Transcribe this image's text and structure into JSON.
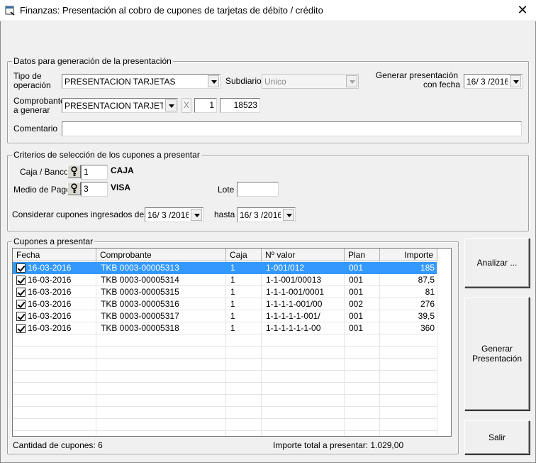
{
  "window": {
    "title": "Finanzas: Presentación al cobro de cupones de tarjetas de débito / crédito",
    "close_glyph": "✕"
  },
  "datos": {
    "legend": "Datos para generación de la presentación",
    "tipo_label_1": "Tipo de",
    "tipo_label_2": "operación",
    "tipo_value": "PRESENTACION TARJETAS",
    "subdiario_label": "Subdiario",
    "subdiario_value": "Unico",
    "generar_label_1": "Generar presentación",
    "generar_label_2": "con fecha",
    "generar_fecha": "16/ 3 /2016",
    "comprobante_label_1": "Comprobante",
    "comprobante_label_2": "a generar",
    "comprobante_value": "PRESENTACION TARJETAS",
    "comprobante_letra": "X",
    "comprobante_sucursal": "1",
    "comprobante_numero": "18523",
    "comentario_label": "Comentario",
    "comentario_value": ""
  },
  "criterios": {
    "legend": "Criterios de selección de los cupones a presentar",
    "caja_label": "Caja / Banco",
    "caja_code": "1",
    "caja_name": "CAJA",
    "medio_label": "Medio de Pago",
    "medio_code": "3",
    "medio_name": "VISA",
    "lote_label": "Lote",
    "lote_value": "",
    "desde_label": "Considerar cupones ingresados desde",
    "desde_value": "16/ 3 /2016",
    "hasta_label": "hasta",
    "hasta_value": "16/ 3 /2016"
  },
  "cupones": {
    "legend": "Cupones a presentar",
    "columns": [
      "Fecha",
      "Comprobante",
      "Caja",
      "Nº valor",
      "Plan",
      "Importe"
    ],
    "rows": [
      {
        "fecha": "16-03-2016",
        "comprobante": "TKB 0003-00005313",
        "caja": "1",
        "nvalor": "1-001/012",
        "plan": "001",
        "importe": "185",
        "selected": true
      },
      {
        "fecha": "16-03-2016",
        "comprobante": "TKB 0003-00005314",
        "caja": "1",
        "nvalor": "1-1-001/00013",
        "plan": "001",
        "importe": "87,5",
        "selected": false
      },
      {
        "fecha": "16-03-2016",
        "comprobante": "TKB 0003-00005315",
        "caja": "1",
        "nvalor": "1-1-1-001/0001",
        "plan": "001",
        "importe": "81",
        "selected": false
      },
      {
        "fecha": "16-03-2016",
        "comprobante": "TKB 0003-00005316",
        "caja": "1",
        "nvalor": "1-1-1-1-001/00",
        "plan": "002",
        "importe": "276",
        "selected": false
      },
      {
        "fecha": "16-03-2016",
        "comprobante": "TKB 0003-00005317",
        "caja": "1",
        "nvalor": "1-1-1-1-1-001/",
        "plan": "001",
        "importe": "39,5",
        "selected": false
      },
      {
        "fecha": "16-03-2016",
        "comprobante": "TKB 0003-00005318",
        "caja": "1",
        "nvalor": "1-1-1-1-1-1-00",
        "plan": "001",
        "importe": "360",
        "selected": false
      }
    ],
    "cantidad_text": "Cantidad de cupones: 6",
    "total_text": "Importe total a presentar: 1.029,00"
  },
  "buttons": {
    "analizar": "Analizar ...",
    "generar_1": "Generar",
    "generar_2": "Presentación",
    "salir": "Salir"
  },
  "colors": {
    "selection": "#3399ff",
    "background": "#f0f0f0"
  }
}
